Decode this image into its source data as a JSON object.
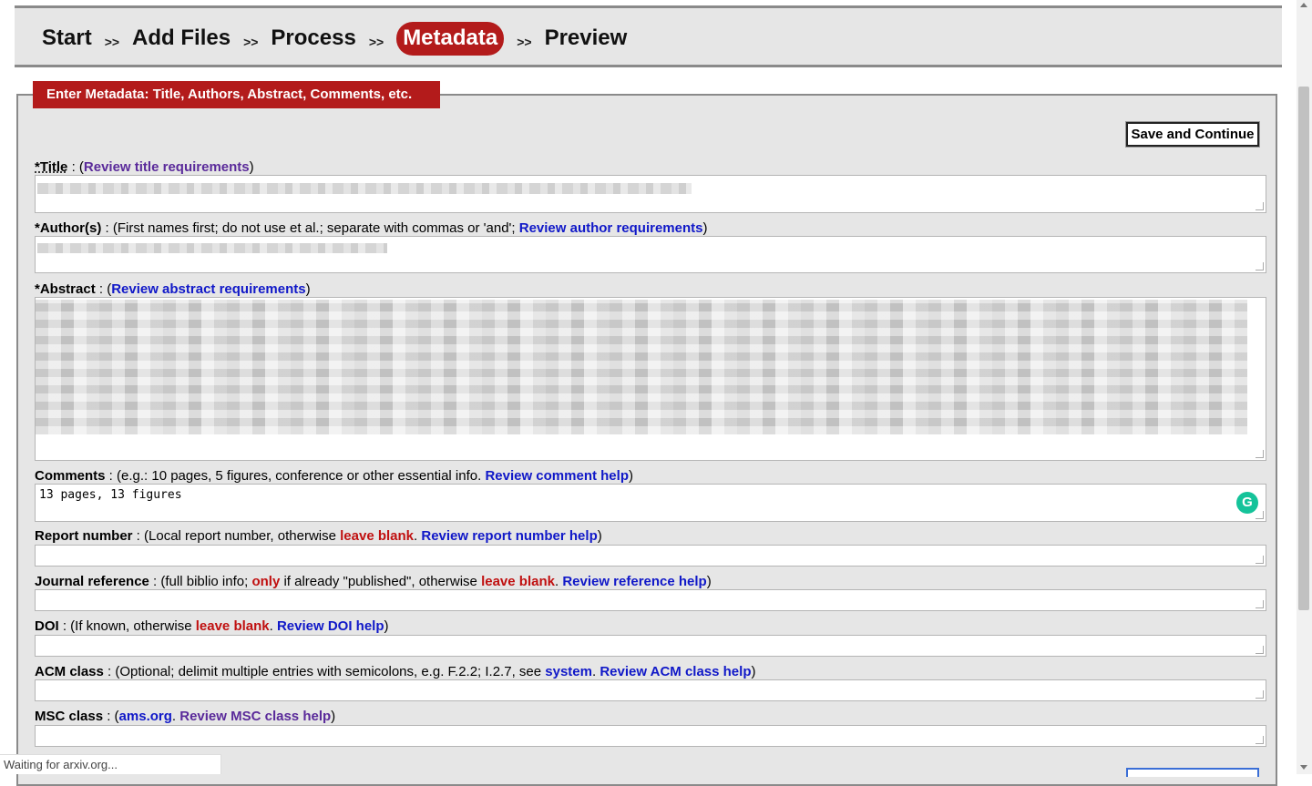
{
  "steps": {
    "start": "Start",
    "add_files": "Add Files",
    "process": "Process",
    "metadata": "Metadata",
    "preview": "Preview",
    "separator": ">>"
  },
  "panel": {
    "legend": "Enter Metadata: Title, Authors, Abstract, Comments, etc.",
    "save_label": "Save and Continue"
  },
  "title": {
    "label": "*Title",
    "sep": " : (",
    "link": "Review title requirements",
    "close": ")"
  },
  "authors": {
    "label": "*Author(s)",
    "note": " : (First names first; do not use et al.; separate with commas or 'and'; ",
    "link": "Review author requirements",
    "close": ")"
  },
  "abstract": {
    "label": "*Abstract",
    "sep": " : (",
    "link": "Review abstract requirements",
    "close": ")"
  },
  "comments": {
    "label": "Comments",
    "note": " : (e.g.: 10 pages, 5 figures, conference or other essential info. ",
    "link": "Review comment help",
    "close": ")",
    "value": "13 pages, 13 figures"
  },
  "report": {
    "label": "Report number",
    "note": " : (Local report number, otherwise ",
    "red": "leave blank",
    "dot": ". ",
    "link": "Review report number help",
    "close": ")"
  },
  "journal": {
    "label": "Journal reference",
    "note1": " : (full biblio info; ",
    "red1": "only",
    "note2": " if already \"published\", otherwise ",
    "red2": "leave blank",
    "dot": ". ",
    "link": "Review reference help",
    "close": ")"
  },
  "doi": {
    "label": "DOI",
    "note": " : (If known, otherwise ",
    "red": "leave blank",
    "dot": ". ",
    "link": "Review DOI help",
    "close": ")"
  },
  "acm": {
    "label": "ACM class",
    "note": " : (Optional; delimit multiple entries with semicolons, e.g. F.2.2; I.2.7, see ",
    "link1": "system",
    "dot": ". ",
    "link2": "Review ACM class help",
    "close": ")"
  },
  "msc": {
    "label": "MSC class",
    "sep": " : (",
    "link1": "ams.org",
    "dot": ". ",
    "link2": "Review MSC class help",
    "close": ")"
  },
  "status_bar": "Waiting for arxiv.org...",
  "icons": {
    "grammarly": "G"
  },
  "colors": {
    "accent": "#b31b1b",
    "link": "#1018c8",
    "visited_link": "#5a2a9a",
    "warning": "#c01010"
  }
}
